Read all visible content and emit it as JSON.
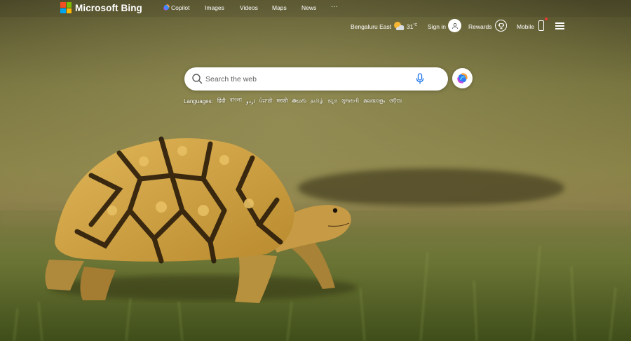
{
  "brand": {
    "name": "Microsoft Bing",
    "logo_colors": [
      "#f25022",
      "#7fba00",
      "#00a4ef",
      "#ffb900"
    ]
  },
  "nav": [
    {
      "label": "Copilot",
      "icon": "copilot-icon"
    },
    {
      "label": "Images"
    },
    {
      "label": "Videos"
    },
    {
      "label": "Maps"
    },
    {
      "label": "News"
    },
    {
      "label": "···"
    }
  ],
  "header": {
    "location": "Bengaluru East",
    "weather_icon": "partly-cloudy-icon",
    "temperature": "31",
    "temp_unit": "°C",
    "sign_in": "Sign in",
    "rewards": "Rewards",
    "mobile": "Mobile"
  },
  "search": {
    "placeholder": "Search the web"
  },
  "languages": {
    "label": "Languages:",
    "items": [
      "हिंदी",
      "বাংলা",
      "اردو",
      "ਪੰਜਾਬੀ",
      "मराठी",
      "తెలుగు",
      "தமிழ்",
      "ಕನ್ನಡ",
      "ગુજરાતી",
      "മലയാളം",
      "ଓଡ଼ିଆ"
    ]
  },
  "colors": {
    "accent_blue": "#1a73e8",
    "notification_red": "#e63b2e"
  }
}
